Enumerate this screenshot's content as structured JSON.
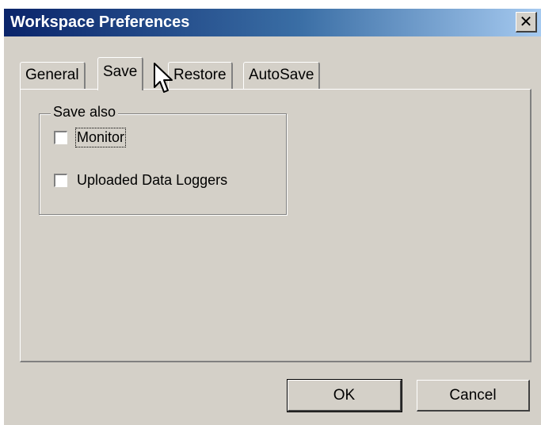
{
  "window": {
    "title": "Workspace Preferences",
    "close_glyph": "✕"
  },
  "tabs": [
    {
      "label": "General",
      "selected": false
    },
    {
      "label": "Save",
      "selected": true
    },
    {
      "label": "Restore",
      "selected": false
    },
    {
      "label": "AutoSave",
      "selected": false
    }
  ],
  "save_also": {
    "legend": "Save also",
    "options": [
      {
        "label": "Monitor",
        "checked": false,
        "focused": true
      },
      {
        "label": "Uploaded Data Loggers",
        "checked": false,
        "focused": false
      }
    ]
  },
  "buttons": {
    "ok": "OK",
    "cancel": "Cancel"
  },
  "colors": {
    "face": "#d4d0c8",
    "title_start": "#0a246a",
    "title_end": "#a6caf0"
  },
  "icons": {
    "cursor": "arrow-pointer-icon"
  }
}
